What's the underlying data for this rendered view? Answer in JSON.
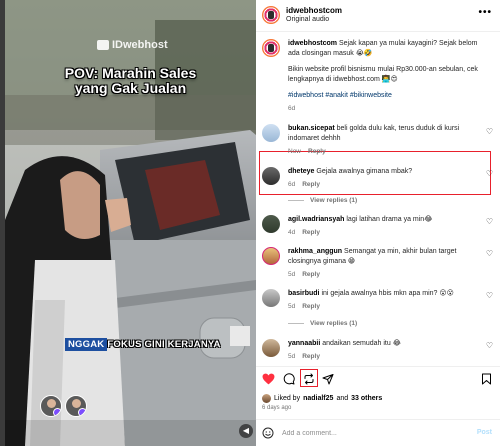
{
  "video": {
    "watermark": "IDwebhost",
    "pov_line1": "POV: Marahin Sales",
    "pov_line2": "yang Gak Jualan",
    "caption_highlight": "NGGAK",
    "caption_rest": "FOKUS GINI KERJANYA"
  },
  "header": {
    "username": "idwebhostcom",
    "subtitle": "Original audio",
    "more": "•••"
  },
  "post": {
    "username": "idwebhostcom",
    "text1": "Sejak kapan ya mulai kayagini? Sejak belom ada closingan masuk 😭🤣",
    "text2": "Bikin website profil bisnismu mulai Rp30.000-an sebulan, cek lengkapnya di idwebhost.com 👨‍💻😍",
    "hashtags": "#idwebhost #anakit #bikinwebsite",
    "time": "6d"
  },
  "comments": [
    {
      "username": "bukan.sicepat",
      "text": "beli golda dulu kak, terus duduk di kursi indomaret dehhh",
      "time": "Now",
      "reply": "Reply"
    },
    {
      "username": "dheteye",
      "text": "Gejala awalnya gimana mbak?",
      "time": "6d",
      "reply": "Reply",
      "view_replies": "View replies (1)"
    },
    {
      "username": "agil.wadriansyah",
      "text": "lagi latihan drama ya min😂",
      "time": "4d",
      "reply": "Reply"
    },
    {
      "username": "rakhma_anggun",
      "text": "Semangat ya min, akhir bulan target closingnya gimana 😁",
      "time": "5d",
      "reply": "Reply"
    },
    {
      "username": "basirbudi",
      "text": "ini gejala awalnya hbis mkn apa min? 😮😮",
      "time": "5d",
      "reply": "Reply",
      "view_replies": "View replies (1)"
    },
    {
      "username": "yannaabii",
      "text": "andaikan semudah itu 😂",
      "time": "5d",
      "reply": "Reply"
    }
  ],
  "actions": {
    "liked_by_prefix": "Liked by",
    "liked_by_user": "nadialf25",
    "liked_by_and": "and",
    "liked_by_count": "33 others",
    "posted_ago": "6 days ago"
  },
  "add_comment": {
    "placeholder": "Add a comment...",
    "post_label": "Post"
  },
  "colors": {
    "highlight_red": "#e8202c",
    "link_blue": "#00376b",
    "like_red": "#ff3040",
    "post_disabled": "#b2dffc"
  }
}
